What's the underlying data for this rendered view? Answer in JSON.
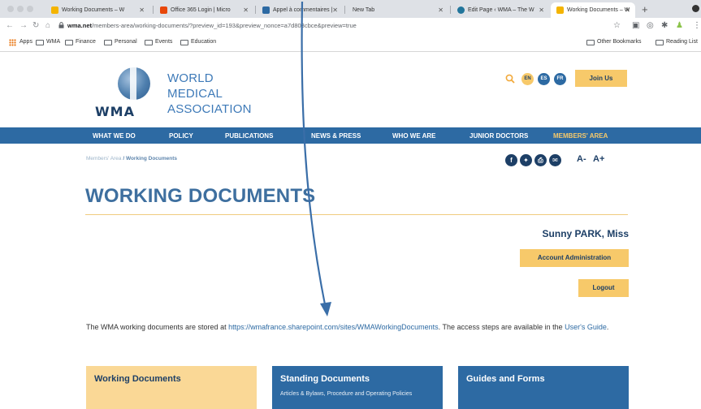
{
  "browser": {
    "tabs": [
      {
        "title": "Working Documents – W",
        "active": false,
        "fav_color": "#f4b400"
      },
      {
        "title": "Office 365 Login | Micro",
        "active": false,
        "fav_color": "#e8470a"
      },
      {
        "title": "Appel à commentaires | ",
        "active": false,
        "fav_color": "#2d6aa3"
      },
      {
        "title": "New Tab",
        "active": false,
        "fav_color": ""
      },
      {
        "title": "Edit Page ‹ WMA – The W",
        "active": false,
        "fav_color": "#21759b"
      },
      {
        "title": "Working Documents – W",
        "active": true,
        "fav_color": "#f4b400"
      }
    ],
    "url_host": "wma.net",
    "url_path": "/members-area/working-documents/?preview_id=193&preview_nonce=a7d803cbce&preview=true",
    "bookmarks": [
      "Apps",
      "WMA",
      "Finance",
      "Personal",
      "Events",
      "Education"
    ],
    "bookmarks_right": [
      "Other Bookmarks",
      "Reading List"
    ]
  },
  "site": {
    "logo_text": "WMA",
    "org_line1": "WORLD",
    "org_line2": "MEDICAL",
    "org_line3": "ASSOCIATION",
    "languages": [
      "EN",
      "ES",
      "FR"
    ],
    "join_label": "Join Us",
    "nav": [
      "WHAT WE DO",
      "POLICY",
      "PUBLICATIONS",
      "NEWS & PRESS",
      "WHO WE ARE",
      "JUNIOR DOCTORS",
      "MEMBERS' AREA"
    ],
    "breadcrumb_parent": "Members' Area",
    "breadcrumb_current": "/ Working Documents",
    "font_smaller": "A-",
    "font_larger": "A+"
  },
  "main": {
    "title": "WORKING DOCUMENTS",
    "user_name": "Sunny PARK, Miss",
    "account_admin_label": "Account Administration",
    "logout_label": "Logout",
    "intro_before": "The WMA working documents are stored at ",
    "intro_link": "https://wmafrance.sharepoint.com/sites/WMAWorkingDocuments",
    "intro_after": ". The access steps are available in the ",
    "intro_guide": "User's Guide",
    "intro_end": ".",
    "cards": [
      {
        "title": "Working Documents",
        "desc": "",
        "color": "#fad896"
      },
      {
        "title": "Standing Documents",
        "desc": "Articles & Bylaws, Procedure and Operating Policies",
        "color": "#2d6aa3"
      },
      {
        "title": "Guides and Forms",
        "desc": "",
        "color": "#2d6aa3"
      }
    ]
  },
  "colors": {
    "brand_blue": "#2d6aa3",
    "accent_gold": "#f7c96a",
    "dark_navy": "#1d3f66"
  }
}
